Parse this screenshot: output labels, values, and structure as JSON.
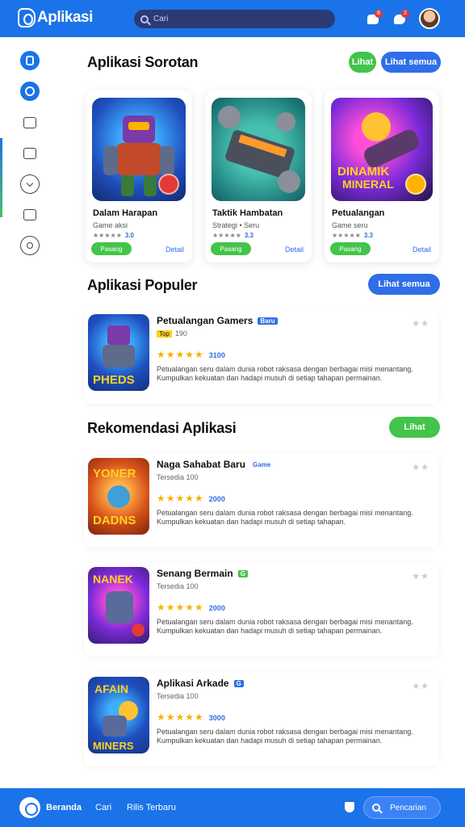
{
  "header": {
    "logo_text": "Aplikasi",
    "search_placeholder": "Cari",
    "notif_count": "8",
    "chat_count": "2"
  },
  "sidebar": {
    "items": [
      {
        "name": "home"
      },
      {
        "name": "games"
      },
      {
        "name": "apps"
      },
      {
        "name": "library"
      },
      {
        "name": "downloads"
      },
      {
        "name": "puzzle"
      },
      {
        "name": "settings"
      }
    ]
  },
  "featured": {
    "title": "Aplikasi Sorotan",
    "btn_primary": "Lihat",
    "btn_secondary": "Lihat semua",
    "cards": [
      {
        "title": "Dalam Harapan",
        "sub": "Game aksi",
        "meta": "★★★★★",
        "rating": "3.0",
        "install": "Pasang",
        "more": "Detail"
      },
      {
        "title": "Taktik Hambatan",
        "sub": "Strategi • Seru",
        "meta": "★★★★★",
        "rating": "3.3",
        "install": "Pasang",
        "more": "Detail"
      },
      {
        "title": "Petualangan",
        "sub": "Game seru",
        "meta": "★★★★★",
        "rating": "3.3",
        "install": "Pasang",
        "more": "Detail"
      }
    ]
  },
  "popular": {
    "title": "Aplikasi Populer",
    "btn": "Lihat semua",
    "rows": [
      {
        "title": "Petualangan Gamers",
        "tag": "Baru",
        "badge": "Top",
        "size": "190",
        "stars": "★★★★★",
        "count": "3100",
        "desc": "Petualangan seru dalam dunia robot raksasa dengan berbagai misi menantang. Kumpulkan kekuatan dan hadapi musuh di setiap tahapan permainan."
      }
    ]
  },
  "recommended": {
    "title": "Rekomendasi Aplikasi",
    "btn": "Lihat",
    "rows": [
      {
        "title": "Naga Sahabat Baru",
        "tag": "Game",
        "size": "Tersedia 100",
        "stars": "★★★★★",
        "count": "2000",
        "desc": "Petualangan seru dalam dunia robot raksasa dengan berbagai misi menantang. Kumpulkan kekuatan dan hadapi musuh di setiap tahapan."
      },
      {
        "title": "Senang Bermain",
        "tag": "G",
        "size": "Tersedia 100",
        "stars": "★★★★★",
        "count": "2000",
        "desc": "Petualangan seru dalam dunia robot raksasa dengan berbagai misi menantang. Kumpulkan kekuatan dan hadapi musuh di setiap tahapan permainan."
      },
      {
        "title": "Aplikasi Arkade",
        "tag": "G",
        "size": "Tersedia 100",
        "stars": "★★★★★",
        "count": "3000",
        "desc": "Petualangan seru dalam dunia robot raksasa dengan berbagai misi menantang. Kumpulkan kekuatan dan hadapi musuh di setiap tahapan permainan."
      }
    ]
  },
  "bottom": {
    "home_label": "Beranda",
    "item2": "Cari",
    "item3": "Rilis Terbaru",
    "search_label": "Pencarian"
  }
}
